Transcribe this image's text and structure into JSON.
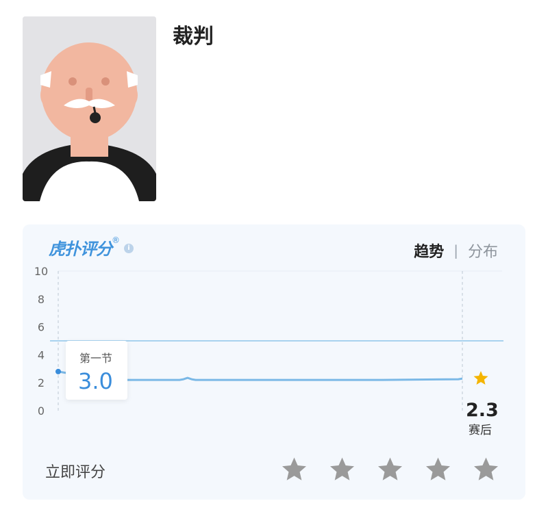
{
  "profile": {
    "name": "裁判"
  },
  "rating_card": {
    "brand": "虎扑评分",
    "brand_reg": "®",
    "info_icon": "i",
    "tabs": {
      "active": "趋势",
      "separator": "|",
      "inactive": "分布"
    },
    "tooltip": {
      "label": "第一节",
      "value": "3.0"
    },
    "final": {
      "value": "2.3",
      "label": "赛后"
    },
    "rate_now_label": "立即评分",
    "star_icon": "star-icon",
    "colors": {
      "accent": "#3f93dc",
      "line": "#7ab8e6",
      "star_gold": "#f4b400",
      "star_gray": "#9a9a9a"
    }
  },
  "chart_data": {
    "type": "line",
    "yticks": [
      "0",
      "2",
      "4",
      "6",
      "8",
      "10"
    ],
    "ylim": [
      0,
      10
    ],
    "reference_line": 5,
    "series": [
      {
        "x": [
          0,
          0.12,
          0.3,
          0.31,
          0.32,
          0.33,
          0.34,
          0.36,
          0.4,
          0.6,
          0.8,
          0.99,
          1
        ],
        "values": [
          2.8,
          2.2,
          2.2,
          2.25,
          2.35,
          2.25,
          2.2,
          2.2,
          2.2,
          2.2,
          2.2,
          2.25,
          2.3
        ]
      }
    ]
  }
}
